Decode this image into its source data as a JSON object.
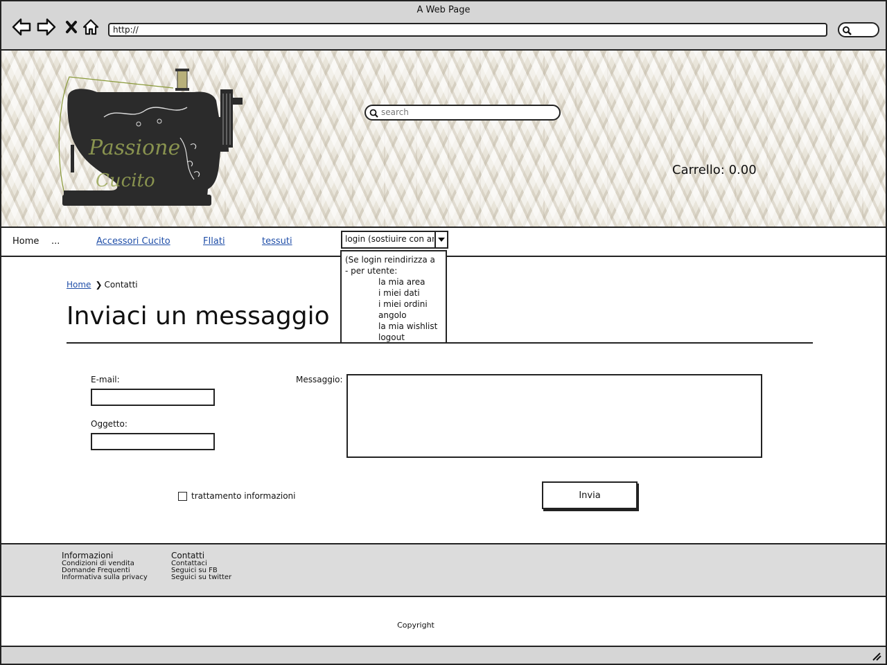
{
  "browser": {
    "title": "A Web Page",
    "url": "http://"
  },
  "header": {
    "logo_text_line1": "Passione",
    "logo_text_line2": "Cucito",
    "search_placeholder": "search",
    "cart_label": "Carrello: 0.00"
  },
  "nav": {
    "items": [
      {
        "label": "Home"
      },
      {
        "label": "..."
      },
      {
        "label": "Accessori Cucito"
      },
      {
        "label": "FIlati"
      },
      {
        "label": "tessuti"
      }
    ],
    "login_select": "login (sostiuire con area",
    "login_dropdown": [
      "(Se login reindirizza a",
      "- per utente:",
      "la mia area",
      "i miei dati",
      "i miei ordini",
      "angolo",
      "la mia wishlist",
      "logout"
    ]
  },
  "breadcrumb": {
    "home": "Home",
    "current": "Contatti"
  },
  "page": {
    "title": "Inviaci un messaggio"
  },
  "form": {
    "email_label": "E-mail:",
    "subject_label": "Oggetto:",
    "message_label": "Messaggio:",
    "email_value": "",
    "subject_value": "",
    "message_value": "",
    "checkbox_label": "trattamento informazioni",
    "checkbox_checked": false,
    "submit_label": "Invia"
  },
  "footer": {
    "col1": {
      "heading": "Informazioni",
      "links": [
        "Condizioni di vendita",
        "Domande Frequenti",
        "Informativa sulla privacy"
      ]
    },
    "col2": {
      "heading": "Contatti",
      "links": [
        "Contattaci",
        "Seguici su FB",
        "Seguici su twitter"
      ]
    },
    "copyright": "Copyright"
  }
}
